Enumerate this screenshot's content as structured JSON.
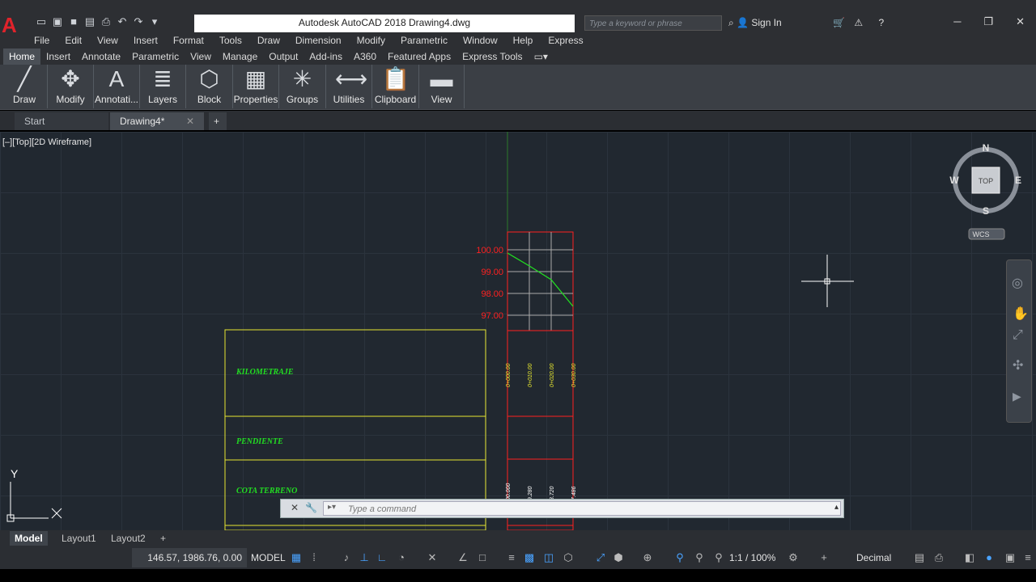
{
  "app": {
    "logo_letter": "A",
    "window_title": "Autodesk AutoCAD 2018    Drawing4.dwg"
  },
  "search": {
    "placeholder": "Type a keyword or phrase"
  },
  "account": {
    "sign_in": "Sign In"
  },
  "menu": [
    "File",
    "Edit",
    "View",
    "Insert",
    "Format",
    "Tools",
    "Draw",
    "Dimension",
    "Modify",
    "Parametric",
    "Window",
    "Help",
    "Express"
  ],
  "ribbon_tabs": [
    "Home",
    "Insert",
    "Annotate",
    "Parametric",
    "View",
    "Manage",
    "Output",
    "Add-ins",
    "A360",
    "Featured Apps",
    "Express Tools"
  ],
  "ribbon_panels": [
    "Draw",
    "Modify",
    "Annotati...",
    "Layers",
    "Block",
    "Properties",
    "Groups",
    "Utilities",
    "Clipboard",
    "View"
  ],
  "file_tabs": {
    "start": "Start",
    "drawing": "Drawing4*",
    "new": "+"
  },
  "viewport": {
    "label": "[–][Top][2D Wireframe]"
  },
  "viewcube": {
    "n": "N",
    "s": "S",
    "e": "E",
    "w": "W",
    "face": "TOP",
    "wcs": "WCS"
  },
  "profile": {
    "elevations": [
      "100.00",
      "99.00",
      "98.00",
      "97.00"
    ],
    "stations": [
      "0+000.00",
      "0+010.00",
      "0+020.00",
      "0+030.00"
    ],
    "cota_values": [
      "100.000",
      "99.280",
      "98.720",
      "97.486"
    ],
    "row_labels": {
      "kilometraje": "KILOMETRAJE",
      "pendiente": "PENDIENTE",
      "cota": "COTA  TERRENO"
    }
  },
  "ucs": {
    "y": "Y"
  },
  "command": {
    "placeholder": "Type a command"
  },
  "layout_tabs": [
    "Model",
    "Layout1",
    "Layout2"
  ],
  "status": {
    "coords": "146.57, 1986.76, 0.00",
    "model": "MODEL",
    "scale": "1:1 / 100%",
    "units": "Decimal"
  },
  "colors": {
    "accent": "#e0232b",
    "grid_bg": "#212830",
    "profile_red": "#ff2020",
    "profile_yellow": "#e6e630",
    "ground_green": "#22dd22"
  }
}
